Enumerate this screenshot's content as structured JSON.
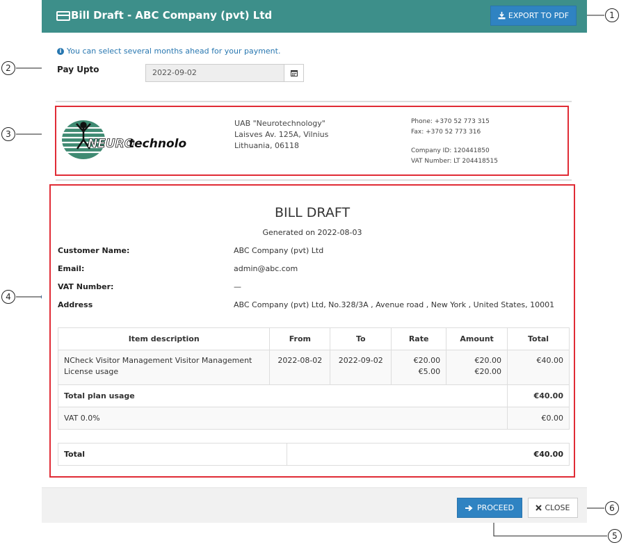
{
  "header": {
    "title": "Bill Draft - ABC Company (pvt) Ltd",
    "export_label": "EXPORT TO PDF"
  },
  "info": "You can select several months ahead for your payment.",
  "pay_upto": {
    "label": "Pay Upto",
    "value": "2022-09-02"
  },
  "company": {
    "logo_text_a": "NEURO",
    "logo_text_b": "technology",
    "address": [
      "UAB \"Neurotechnology\"",
      "Laisves Av. 125A, Vilnius",
      "Lithuania, 06118"
    ],
    "phone": "Phone: +370 52 773 315",
    "fax": "Fax: +370 52 773 316",
    "company_id": "Company ID: 120441850",
    "vat_number": "VAT Number: LT 204418515"
  },
  "bill": {
    "title": "BILL DRAFT",
    "generated": "Generated on 2022-08-03",
    "customer_label": "Customer Name:",
    "customer": "ABC Company (pvt) Ltd",
    "email_label": "Email:",
    "email": "admin@abc.com",
    "vat_label": "VAT Number:",
    "vat": "—",
    "address_label": "Address",
    "address": "ABC Company (pvt) Ltd, No.328/3A , Avenue road , New York , United States, 10001",
    "columns": [
      "Item description",
      "From",
      "To",
      "Rate",
      "Amount",
      "Total"
    ],
    "item": {
      "description": "NCheck Visitor Management Visitor Management License usage",
      "from": "2022-08-02",
      "to": "2022-09-02",
      "rate1": "€20.00",
      "rate2": "€5.00",
      "amount1": "€20.00",
      "amount2": "€20.00",
      "total": "€40.00"
    },
    "plan_label": "Total plan usage",
    "plan_total": "€40.00",
    "vat_row_label": "VAT 0.0%",
    "vat_row_total": "€0.00",
    "total_label": "Total",
    "total_value": "€40.00"
  },
  "footer": {
    "proceed_label": "PROCEED",
    "close_label": "CLOSE"
  },
  "callouts": [
    "1",
    "2",
    "3",
    "4",
    "5",
    "6"
  ],
  "colors": {
    "header": "#3d8f8a",
    "primary": "#2f83c2",
    "highlight": "#e02b35",
    "info": "#2877b0"
  }
}
